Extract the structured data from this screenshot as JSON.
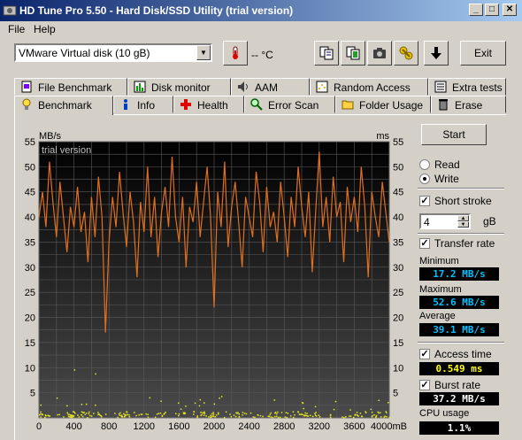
{
  "window": {
    "title": "HD Tune Pro 5.50 - Hard Disk/SSD Utility (trial version)",
    "minimize": "_",
    "maximize": "□",
    "close": "✕"
  },
  "menu": {
    "file": "File",
    "help": "Help"
  },
  "toolbar": {
    "drive": "VMware  Virtual disk (10 gB)",
    "temperature": "-- °C",
    "exit": "Exit"
  },
  "tabs_top": [
    {
      "label": "File Benchmark",
      "icon": "file-benchmark-icon"
    },
    {
      "label": "Disk monitor",
      "icon": "disk-monitor-icon"
    },
    {
      "label": "AAM",
      "icon": "speaker-icon"
    },
    {
      "label": "Random Access",
      "icon": "random-access-icon"
    },
    {
      "label": "Extra tests",
      "icon": "extra-tests-icon"
    }
  ],
  "tabs_bottom": [
    {
      "label": "Benchmark",
      "icon": "benchmark-icon",
      "active": true
    },
    {
      "label": "Info",
      "icon": "info-icon"
    },
    {
      "label": "Health",
      "icon": "health-icon"
    },
    {
      "label": "Error Scan",
      "icon": "error-scan-icon"
    },
    {
      "label": "Folder Usage",
      "icon": "folder-icon"
    },
    {
      "label": "Erase",
      "icon": "erase-icon"
    }
  ],
  "controls": {
    "start": "Start",
    "read": "Read",
    "write": "Write",
    "mode_selected": "write",
    "short_stroke": "Short stroke",
    "short_stroke_checked": true,
    "stroke_value": "4",
    "stroke_unit": "gB",
    "transfer_rate": "Transfer rate",
    "transfer_rate_checked": true,
    "access_time": "Access time",
    "access_time_checked": true,
    "burst_rate": "Burst rate",
    "burst_rate_checked": true
  },
  "stats": {
    "minimum_label": "Minimum",
    "minimum": "17.2 MB/s",
    "maximum_label": "Maximum",
    "maximum": "52.6 MB/s",
    "average_label": "Average",
    "average": "39.1 MB/s",
    "access_time": "0.549 ms",
    "burst_rate": "37.2 MB/s",
    "cpu_label": "CPU usage",
    "cpu": "1.1%"
  },
  "colors": {
    "transfer": "#e07020",
    "access": "#e8e820",
    "value_cyan": "#00c0ff",
    "value_yellow": "#ffff00",
    "value_white": "#ffffff"
  },
  "chart_data": {
    "type": "line",
    "watermark": "trial version",
    "y_left_unit": "MB/s",
    "y_right_unit": "ms",
    "ylim": [
      0,
      55
    ],
    "yticks": [
      5,
      10,
      15,
      20,
      25,
      30,
      35,
      40,
      45,
      50,
      55
    ],
    "xlim": [
      0,
      4000
    ],
    "xticks": [
      "0",
      "400",
      "800",
      "1200",
      "1600",
      "2000",
      "2400",
      "2800",
      "3200",
      "3600",
      "4000mB"
    ],
    "grid": true,
    "series": [
      {
        "kind": "transfer_rate",
        "x": [
          0,
          40,
          80,
          120,
          160,
          200,
          240,
          280,
          320,
          360,
          400,
          440,
          480,
          520,
          560,
          600,
          640,
          680,
          720,
          760,
          800,
          840,
          880,
          920,
          960,
          1000,
          1040,
          1080,
          1120,
          1160,
          1200,
          1240,
          1280,
          1320,
          1360,
          1400,
          1440,
          1480,
          1520,
          1560,
          1600,
          1640,
          1680,
          1720,
          1760,
          1800,
          1840,
          1880,
          1920,
          1960,
          2000,
          2040,
          2080,
          2120,
          2160,
          2200,
          2240,
          2280,
          2320,
          2360,
          2400,
          2440,
          2480,
          2520,
          2560,
          2600,
          2640,
          2680,
          2720,
          2760,
          2800,
          2840,
          2880,
          2920,
          2960,
          3000,
          3040,
          3080,
          3120,
          3160,
          3200,
          3240,
          3280,
          3320,
          3360,
          3400,
          3440,
          3480,
          3520,
          3560,
          3600,
          3640,
          3680,
          3720,
          3760,
          3800,
          3840,
          3880,
          3920,
          3960,
          4000
        ],
        "y": [
          40,
          45,
          38,
          51,
          43,
          36,
          47,
          40,
          33,
          42,
          38,
          46,
          37,
          41,
          31,
          44,
          36,
          48,
          40,
          17,
          35,
          44,
          38,
          49,
          41,
          34,
          45,
          39,
          28,
          43,
          37,
          50,
          36,
          44,
          32,
          41,
          46,
          38,
          52,
          40,
          35,
          44,
          30,
          42,
          39,
          47,
          36,
          43,
          50,
          40,
          22,
          45,
          38,
          51,
          34,
          42,
          47,
          39,
          30,
          44,
          40,
          36,
          49,
          43,
          33,
          46,
          38,
          41,
          35,
          47,
          40,
          32,
          44,
          38,
          50,
          42,
          36,
          45,
          29,
          41,
          53,
          38,
          44,
          35,
          48,
          40,
          43,
          31,
          46,
          39,
          44,
          37,
          50,
          42,
          28,
          45,
          40,
          36,
          47,
          41,
          35
        ]
      }
    ],
    "access_time_points": "scatter near 0–3 ms across full range"
  }
}
